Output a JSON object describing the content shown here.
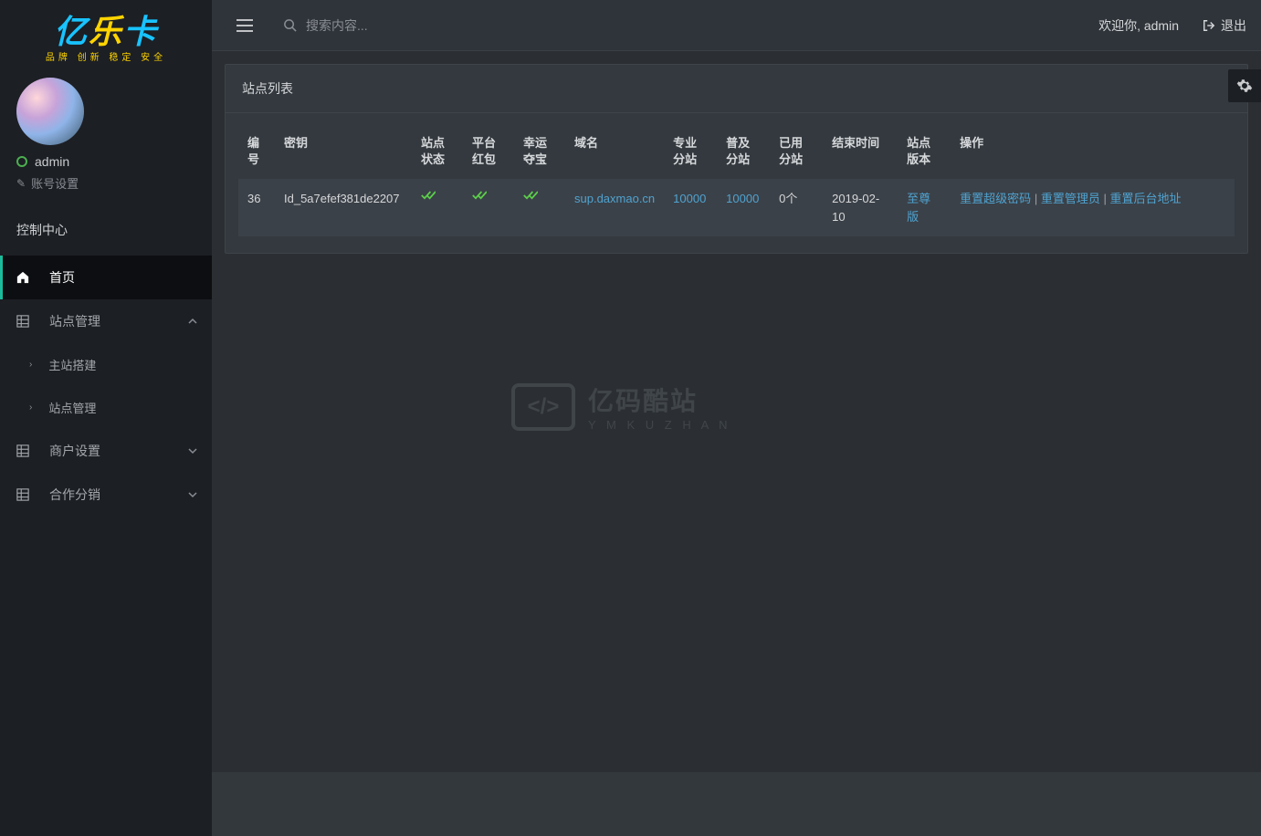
{
  "logo": {
    "tagline": "品牌 创新 稳定 安全"
  },
  "user": {
    "name": "admin",
    "settings_label": "账号设置"
  },
  "nav": {
    "section": "控制中心",
    "home": "首页",
    "site_mgmt": "站点管理",
    "site_mgmt_sub": {
      "build": "主站搭建",
      "manage": "站点管理"
    },
    "merchant": "商户设置",
    "partner": "合作分销"
  },
  "topbar": {
    "search_placeholder": "搜索内容...",
    "welcome": "欢迎你, admin",
    "logout": "退出"
  },
  "panel": {
    "title": "站点列表"
  },
  "table": {
    "headers": {
      "id": "编号",
      "key": "密钥",
      "status": "站点状态",
      "redpack": "平台红包",
      "lucky": "幸运夺宝",
      "domain": "域名",
      "pro": "专业分站",
      "pop": "普及分站",
      "used": "已用分站",
      "end": "结束时间",
      "ver": "站点版本",
      "ops": "操作"
    },
    "row": {
      "id": "36",
      "key": "Id_5a7efef381de2207",
      "domain": "sup.daxmao.cn",
      "pro": "10000",
      "pop": "10000",
      "used": "0个",
      "end": "2019-02-10",
      "ver": "至尊版",
      "ops": {
        "reset_pwd": "重置超级密码",
        "reset_admin": "重置管理员",
        "reset_backend": "重置后台地址"
      }
    }
  },
  "watermark": {
    "title": "亿码酷站",
    "sub": "Y M K U Z H A N"
  }
}
